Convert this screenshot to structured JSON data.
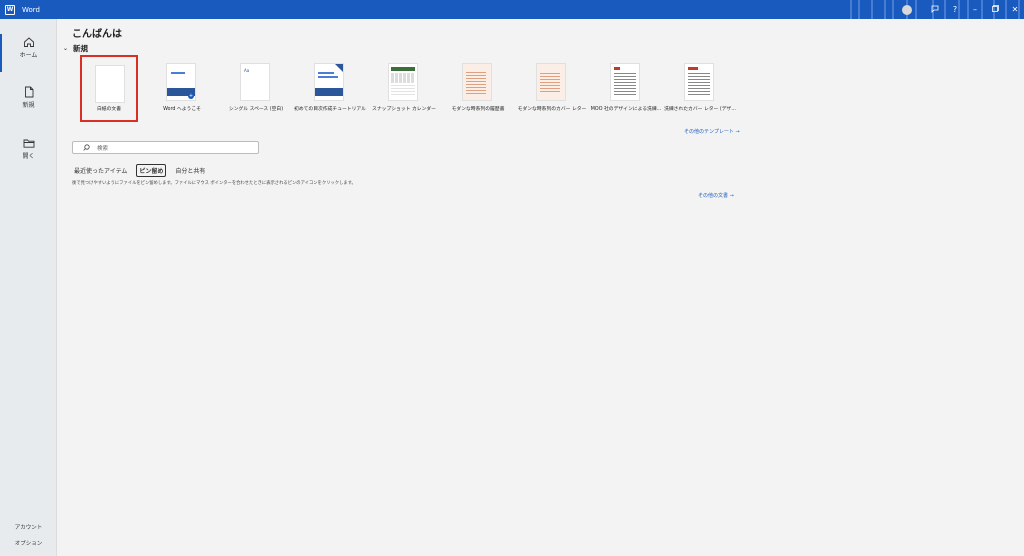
{
  "app": {
    "name": "Word",
    "icon": "word-icon"
  },
  "window_controls": [
    "avatar",
    "feedback-icon",
    "help-icon",
    "minimize-icon",
    "restore-icon",
    "close-icon"
  ],
  "sidebar": {
    "items": [
      {
        "label": "ホーム",
        "icon": "home-icon",
        "active": true
      },
      {
        "label": "新規",
        "icon": "new-document-icon",
        "active": false
      },
      {
        "label": "開く",
        "icon": "folder-open-icon",
        "active": false
      }
    ],
    "bottom": [
      {
        "label": "アカウント"
      },
      {
        "label": "オプション"
      }
    ]
  },
  "main": {
    "greeting": "こんばんは",
    "new_section": {
      "title": "新規"
    },
    "templates": [
      {
        "label": "白紙の文書",
        "selected": true
      },
      {
        "label": "Word へようこそ"
      },
      {
        "label": "シングル スペース (空白)"
      },
      {
        "label": "初めての目次作成チュートリアル"
      },
      {
        "label": "スナップショット カレンダー"
      },
      {
        "label": "モダンな時系列の履歴書"
      },
      {
        "label": "モダンな時系列のカバー レター"
      },
      {
        "label": "MOO 社のデザインによる洗練..."
      },
      {
        "label": "洗練されたカバー レター (デザ..."
      }
    ],
    "more_templates": "その他のテンプレート →",
    "search": {
      "placeholder": "検索"
    },
    "tabs": [
      {
        "label": "最近使ったアイテム"
      },
      {
        "label": "ピン留め",
        "active": true
      },
      {
        "label": "自分と共有"
      }
    ],
    "hint": "後で見つけやすいようにファイルをピン留めします。ファイルにマウス ポインターを合わせたときに表示されるピンのアイコンをクリックします。",
    "more_documents": "その他の文書 →"
  },
  "colors": {
    "accent": "#185abd",
    "selection": "#d93025",
    "sidebar": "#e8ebee",
    "background": "#f3f3f3"
  }
}
